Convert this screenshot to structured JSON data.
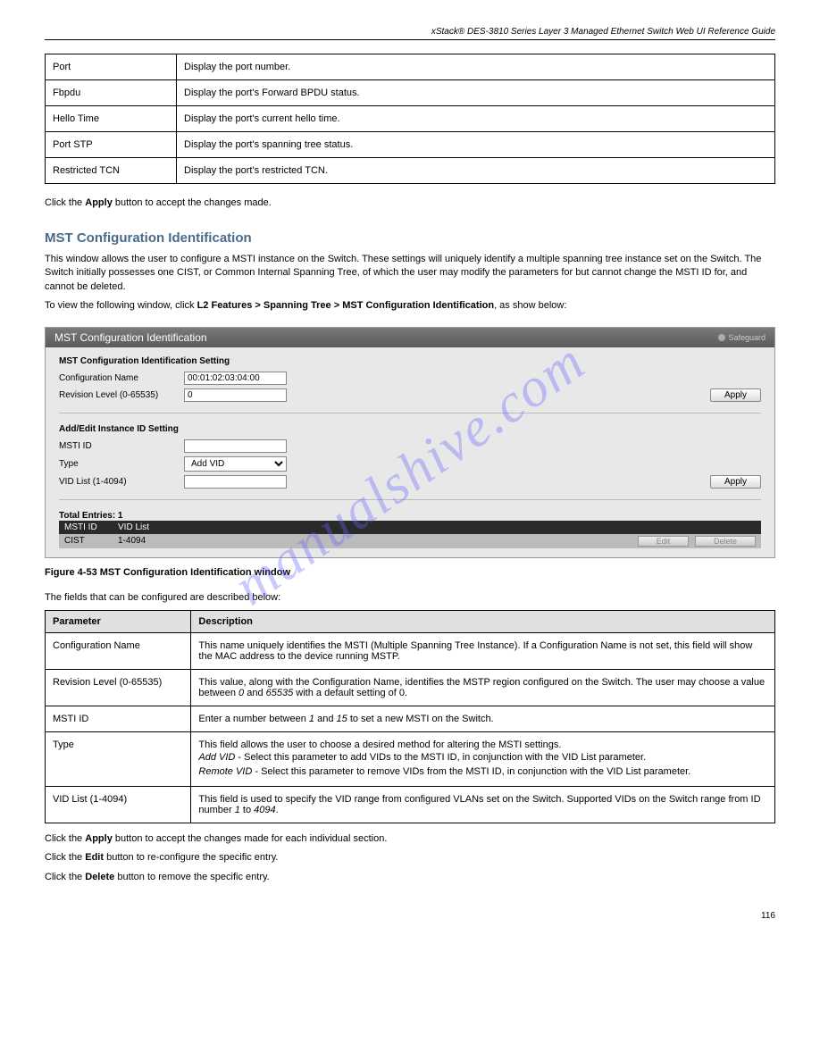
{
  "page_header": "xStack® DES-3810 Series Layer 3 Managed Ethernet Switch Web UI Reference Guide",
  "watermark": "manualshive.com",
  "table1": [
    [
      "Port",
      "Display the port number."
    ],
    [
      "Fbpdu",
      "Display the port's Forward BPDU status."
    ],
    [
      "Hello Time",
      "Display the port's current hello time."
    ],
    [
      "Port STP",
      "Display the port's spanning tree status."
    ],
    [
      "Restricted TCN",
      "Display the port's restricted TCN."
    ]
  ],
  "apply_note": {
    "pre": "Click the ",
    "btn": "Apply",
    "post": " button to accept the changes made."
  },
  "section_heading": "MST Configuration Identification",
  "section_para1": "This window allows the user to configure a MSTI instance on the Switch. These settings will uniquely identify a multiple spanning tree instance set on the Switch. The Switch initially possesses one CIST, or Common Internal Spanning Tree, of which the user may modify the parameters for but cannot change the MSTI ID for, and cannot be deleted.",
  "nav_path": {
    "pre": "To view the following window, click ",
    "path": "L2 Features > Spanning Tree > MST Configuration Identification",
    "post": ", as show below:"
  },
  "panel": {
    "title": "MST Configuration Identification",
    "safeguard": "Safeguard",
    "section1_title": "MST Configuration Identification Setting",
    "config_name_label": "Configuration Name",
    "config_name_value": "00:01:02:03:04:00",
    "revision_label": "Revision Level (0-65535)",
    "revision_value": "0",
    "apply_label": "Apply",
    "section2_title": "Add/Edit Instance ID Setting",
    "msti_label": "MSTI ID",
    "msti_value": "",
    "type_label": "Type",
    "type_value": "Add VID",
    "vidlist_label": "VID List (1-4094)",
    "vidlist_value": "",
    "total_entries": "Total Entries: 1",
    "headers": [
      "MSTI ID",
      "VID List"
    ],
    "row": [
      "CIST",
      "1-4094"
    ],
    "edit_btn": "Edit",
    "delete_btn": "Delete"
  },
  "figure_caption": "Figure 4-53 MST Configuration Identification window",
  "param_intro": "The fields that can be configured are described below:",
  "param_headers": [
    "Parameter",
    "Description"
  ],
  "param_rows": [
    {
      "name": "Configuration Name",
      "desc": "This name uniquely identifies the MSTI (Multiple Spanning Tree Instance). If a Configuration Name is not set, this field will show the MAC address to the device running MSTP."
    },
    {
      "name": "Revision Level (0-65535)",
      "desc_pre": "This value, along with the Configuration Name, identifies the MSTP region configured on the Switch. The user may choose a value between ",
      "r1": "0",
      "mid": " and ",
      "r2": "65535",
      "end": " with a default setting of 0."
    },
    {
      "name": "MSTI ID",
      "desc_pre": "Enter a number between ",
      "r1": "1",
      "mid": " and ",
      "r2": "15",
      "end": " to set a new MSTI on the Switch."
    },
    {
      "name": "Type",
      "intro": "This field allows the user to choose a desired method for altering the MSTI settings.",
      "items": [
        {
          "n": "Add VID",
          "d": " - Select this parameter to add VIDs to the MSTI ID, in conjunction with the VID List parameter."
        },
        {
          "n": "Remote VID",
          "d": " - Select this parameter to remove VIDs from the MSTI ID, in conjunction with the VID List parameter."
        }
      ]
    },
    {
      "name": "VID List (1-4094)",
      "desc": "This field is used to specify the VID range from configured VLANs set on the Switch. Supported VIDs on the Switch range from ID number ",
      "r1": "1",
      "mid": " to ",
      "r2": "4094",
      "end": "."
    }
  ],
  "footer_notes": [
    {
      "pre": "Click the ",
      "btn": "Apply",
      "post": " button to accept the changes made for each individual section."
    },
    {
      "pre": "Click the ",
      "btn": "Edit",
      "post": " button to re-configure the specific entry."
    },
    {
      "pre": "Click the ",
      "btn": "Delete",
      "post": " button to remove the specific entry."
    }
  ],
  "page_number": "116"
}
